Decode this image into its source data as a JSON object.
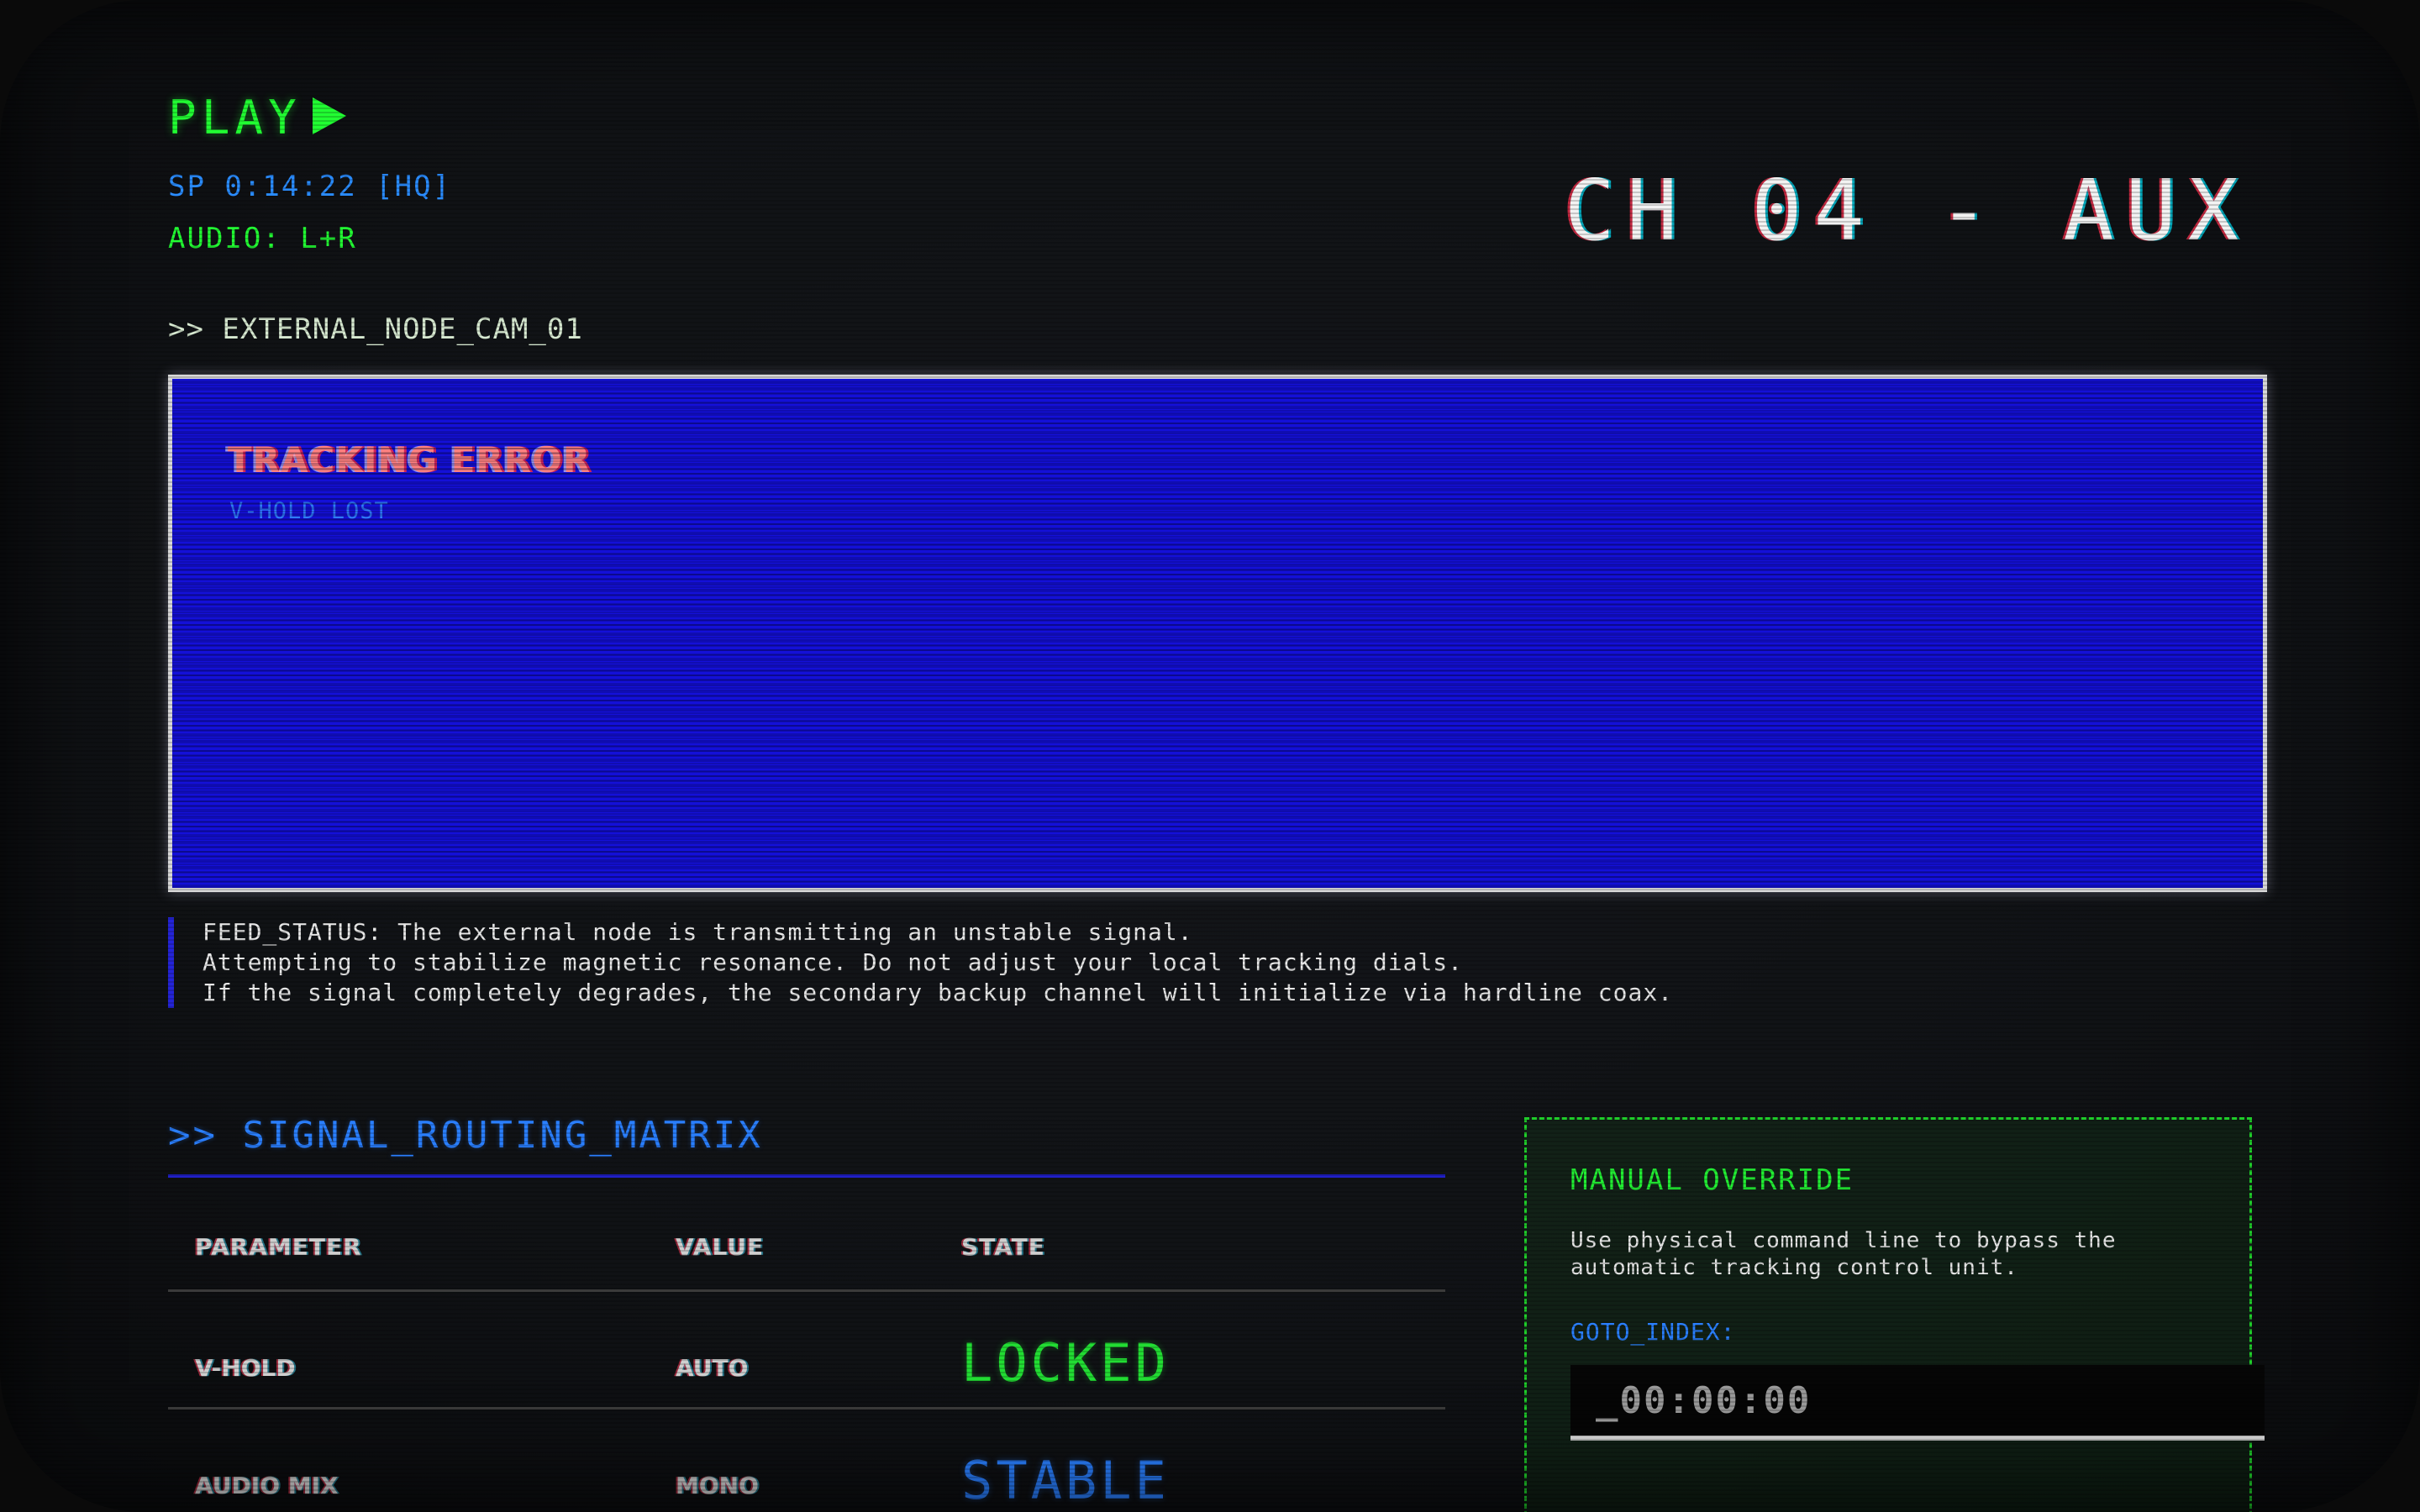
{
  "status": {
    "mode": "PLAY",
    "tape_time": "SP 0:14:22 [HQ]",
    "audio": "AUDIO: L+R"
  },
  "channel": "CH 04 - AUX",
  "feed": {
    "label": ">> EXTERNAL_NODE_CAM_01",
    "error_title": "TRACKING ERROR",
    "error_detail": "V-HOLD LOST",
    "background_color": "#1410d8",
    "status_lines": [
      "FEED_STATUS: The external node is transmitting an unstable signal.",
      "Attempting to stabilize magnetic resonance. Do not adjust your local tracking dials.",
      "If the signal completely degrades, the secondary backup channel will initialize via hardline coax."
    ]
  },
  "routing": {
    "title": ">> SIGNAL_ROUTING_MATRIX",
    "headers": [
      "PARAMETER",
      "VALUE",
      "STATE"
    ],
    "rows": [
      {
        "parameter": "V-HOLD",
        "value": "AUTO",
        "state": "LOCKED",
        "state_color": "#22dd33"
      },
      {
        "parameter": "AUDIO MIX",
        "value": "MONO",
        "state": "STABLE",
        "state_color": "#2a7fff"
      }
    ]
  },
  "override": {
    "title": "MANUAL OVERRIDE",
    "description_lines": [
      "Use physical command line to bypass the",
      "automatic tracking control unit."
    ],
    "goto_label": "GOTO_INDEX:",
    "goto_placeholder": "_00:00:00"
  },
  "colors": {
    "accent_green": "#22ff33",
    "accent_blue": "#2a7fff",
    "video_blue": "#1410d8",
    "error_red": "#ff8080"
  },
  "icons": {
    "play": "play-triangle-icon"
  }
}
